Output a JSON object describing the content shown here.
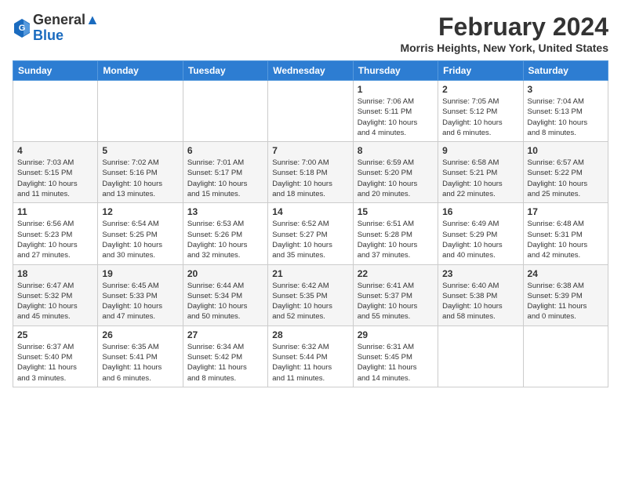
{
  "header": {
    "logo_line1": "General",
    "logo_line2": "Blue",
    "title": "February 2024",
    "subtitle": "Morris Heights, New York, United States"
  },
  "calendar": {
    "days_of_week": [
      "Sunday",
      "Monday",
      "Tuesday",
      "Wednesday",
      "Thursday",
      "Friday",
      "Saturday"
    ],
    "weeks": [
      [
        {
          "day": "",
          "info": ""
        },
        {
          "day": "",
          "info": ""
        },
        {
          "day": "",
          "info": ""
        },
        {
          "day": "",
          "info": ""
        },
        {
          "day": "1",
          "info": "Sunrise: 7:06 AM\nSunset: 5:11 PM\nDaylight: 10 hours\nand 4 minutes."
        },
        {
          "day": "2",
          "info": "Sunrise: 7:05 AM\nSunset: 5:12 PM\nDaylight: 10 hours\nand 6 minutes."
        },
        {
          "day": "3",
          "info": "Sunrise: 7:04 AM\nSunset: 5:13 PM\nDaylight: 10 hours\nand 8 minutes."
        }
      ],
      [
        {
          "day": "4",
          "info": "Sunrise: 7:03 AM\nSunset: 5:15 PM\nDaylight: 10 hours\nand 11 minutes."
        },
        {
          "day": "5",
          "info": "Sunrise: 7:02 AM\nSunset: 5:16 PM\nDaylight: 10 hours\nand 13 minutes."
        },
        {
          "day": "6",
          "info": "Sunrise: 7:01 AM\nSunset: 5:17 PM\nDaylight: 10 hours\nand 15 minutes."
        },
        {
          "day": "7",
          "info": "Sunrise: 7:00 AM\nSunset: 5:18 PM\nDaylight: 10 hours\nand 18 minutes."
        },
        {
          "day": "8",
          "info": "Sunrise: 6:59 AM\nSunset: 5:20 PM\nDaylight: 10 hours\nand 20 minutes."
        },
        {
          "day": "9",
          "info": "Sunrise: 6:58 AM\nSunset: 5:21 PM\nDaylight: 10 hours\nand 22 minutes."
        },
        {
          "day": "10",
          "info": "Sunrise: 6:57 AM\nSunset: 5:22 PM\nDaylight: 10 hours\nand 25 minutes."
        }
      ],
      [
        {
          "day": "11",
          "info": "Sunrise: 6:56 AM\nSunset: 5:23 PM\nDaylight: 10 hours\nand 27 minutes."
        },
        {
          "day": "12",
          "info": "Sunrise: 6:54 AM\nSunset: 5:25 PM\nDaylight: 10 hours\nand 30 minutes."
        },
        {
          "day": "13",
          "info": "Sunrise: 6:53 AM\nSunset: 5:26 PM\nDaylight: 10 hours\nand 32 minutes."
        },
        {
          "day": "14",
          "info": "Sunrise: 6:52 AM\nSunset: 5:27 PM\nDaylight: 10 hours\nand 35 minutes."
        },
        {
          "day": "15",
          "info": "Sunrise: 6:51 AM\nSunset: 5:28 PM\nDaylight: 10 hours\nand 37 minutes."
        },
        {
          "day": "16",
          "info": "Sunrise: 6:49 AM\nSunset: 5:29 PM\nDaylight: 10 hours\nand 40 minutes."
        },
        {
          "day": "17",
          "info": "Sunrise: 6:48 AM\nSunset: 5:31 PM\nDaylight: 10 hours\nand 42 minutes."
        }
      ],
      [
        {
          "day": "18",
          "info": "Sunrise: 6:47 AM\nSunset: 5:32 PM\nDaylight: 10 hours\nand 45 minutes."
        },
        {
          "day": "19",
          "info": "Sunrise: 6:45 AM\nSunset: 5:33 PM\nDaylight: 10 hours\nand 47 minutes."
        },
        {
          "day": "20",
          "info": "Sunrise: 6:44 AM\nSunset: 5:34 PM\nDaylight: 10 hours\nand 50 minutes."
        },
        {
          "day": "21",
          "info": "Sunrise: 6:42 AM\nSunset: 5:35 PM\nDaylight: 10 hours\nand 52 minutes."
        },
        {
          "day": "22",
          "info": "Sunrise: 6:41 AM\nSunset: 5:37 PM\nDaylight: 10 hours\nand 55 minutes."
        },
        {
          "day": "23",
          "info": "Sunrise: 6:40 AM\nSunset: 5:38 PM\nDaylight: 10 hours\nand 58 minutes."
        },
        {
          "day": "24",
          "info": "Sunrise: 6:38 AM\nSunset: 5:39 PM\nDaylight: 11 hours\nand 0 minutes."
        }
      ],
      [
        {
          "day": "25",
          "info": "Sunrise: 6:37 AM\nSunset: 5:40 PM\nDaylight: 11 hours\nand 3 minutes."
        },
        {
          "day": "26",
          "info": "Sunrise: 6:35 AM\nSunset: 5:41 PM\nDaylight: 11 hours\nand 6 minutes."
        },
        {
          "day": "27",
          "info": "Sunrise: 6:34 AM\nSunset: 5:42 PM\nDaylight: 11 hours\nand 8 minutes."
        },
        {
          "day": "28",
          "info": "Sunrise: 6:32 AM\nSunset: 5:44 PM\nDaylight: 11 hours\nand 11 minutes."
        },
        {
          "day": "29",
          "info": "Sunrise: 6:31 AM\nSunset: 5:45 PM\nDaylight: 11 hours\nand 14 minutes."
        },
        {
          "day": "",
          "info": ""
        },
        {
          "day": "",
          "info": ""
        }
      ]
    ]
  }
}
